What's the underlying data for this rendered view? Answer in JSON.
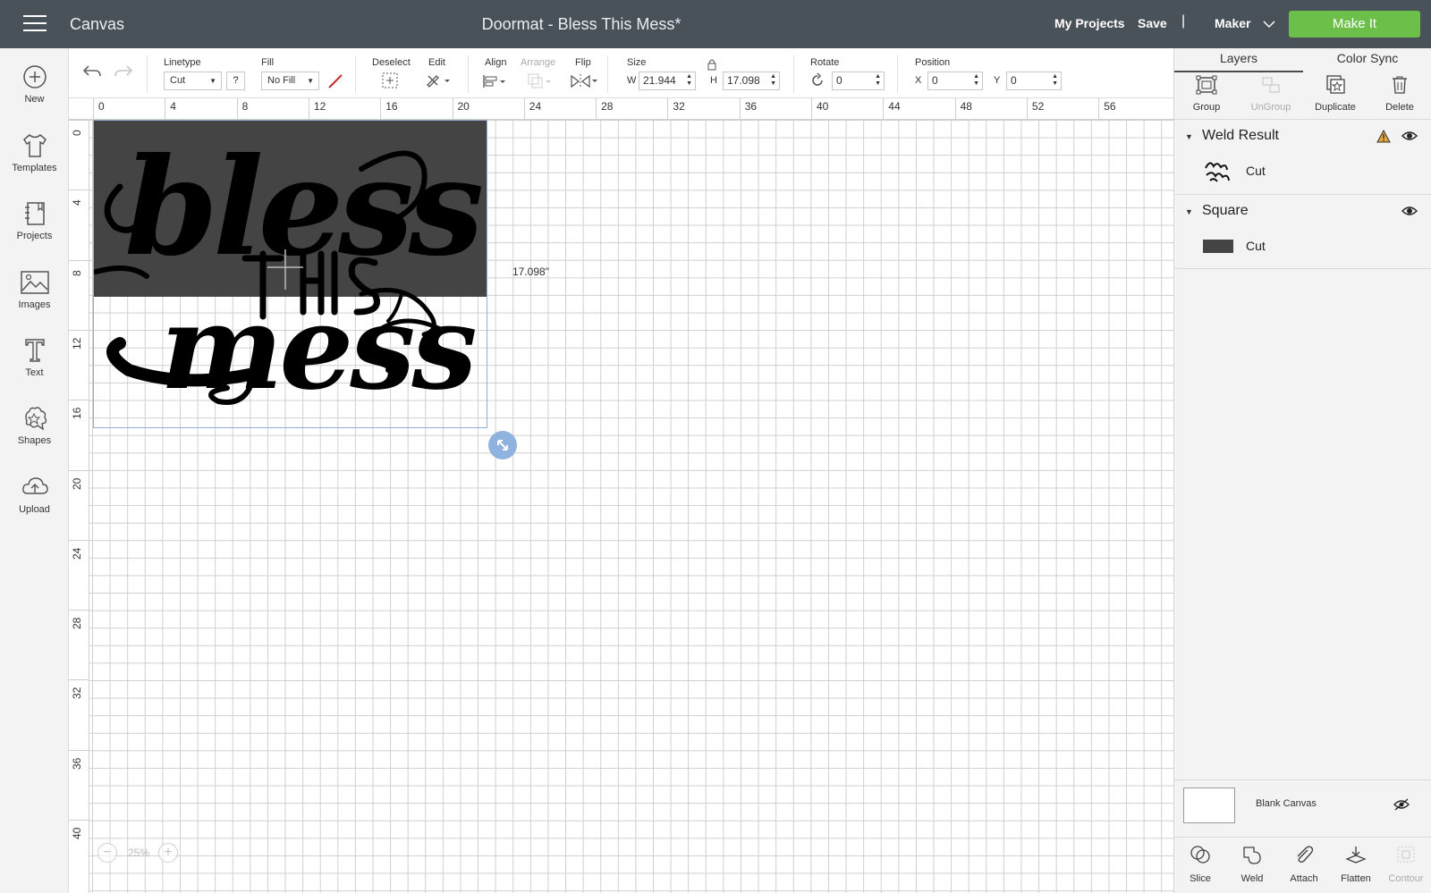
{
  "topbar": {
    "app_title": "Canvas",
    "document_title": "Doormat - Bless This Mess*",
    "my_projects": "My Projects",
    "save": "Save",
    "separator": "|",
    "machine": "Maker",
    "make_it": "Make It",
    "make_it_color": "#6cc04a",
    "bar_color": "#4a5259"
  },
  "leftnav": {
    "items": [
      {
        "label": "New",
        "icon": "plus-circle-icon"
      },
      {
        "label": "Templates",
        "icon": "shirt-icon"
      },
      {
        "label": "Projects",
        "icon": "notebook-icon"
      },
      {
        "label": "Images",
        "icon": "image-icon"
      },
      {
        "label": "Text",
        "icon": "text-t-icon"
      },
      {
        "label": "Shapes",
        "icon": "shapes-icon"
      },
      {
        "label": "Upload",
        "icon": "cloud-upload-icon"
      }
    ]
  },
  "toolbar": {
    "linetype_label": "Linetype",
    "linetype_value": "Cut",
    "help": "?",
    "fill_label": "Fill",
    "fill_value": "No Fill",
    "deselect_label": "Deselect",
    "edit_label": "Edit",
    "align_label": "Align",
    "arrange_label": "Arrange",
    "flip_label": "Flip",
    "size_label": "Size",
    "w_prefix": "W",
    "width": "21.944",
    "h_prefix": "H",
    "height": "17.098",
    "rotate_label": "Rotate",
    "rotate_value": "0",
    "position_label": "Position",
    "x_prefix": "X",
    "x_value": "0",
    "y_prefix": "Y",
    "y_value": "0"
  },
  "rulers": {
    "top": [
      "0",
      "4",
      "8",
      "12",
      "16",
      "20",
      "24",
      "28",
      "32",
      "36",
      "40",
      "44",
      "48",
      "52",
      "56"
    ],
    "left": [
      "0",
      "4",
      "8",
      "12",
      "16",
      "20",
      "24",
      "28",
      "32",
      "36",
      "40"
    ]
  },
  "canvas": {
    "dimension_label": "17.098\"",
    "zoom_level": "25%",
    "zoom_out": "−",
    "zoom_in": "+",
    "artwork_words": [
      "bless",
      "THIS",
      "mess"
    ]
  },
  "panel": {
    "tabs": [
      "Layers",
      "Color Sync"
    ],
    "actions": [
      {
        "label": "Group",
        "enabled": true
      },
      {
        "label": "UnGroup",
        "enabled": false
      },
      {
        "label": "Duplicate",
        "enabled": true
      },
      {
        "label": "Delete",
        "enabled": true
      }
    ],
    "layers": [
      {
        "name": "Weld Result",
        "child": "Cut",
        "warning": true
      },
      {
        "name": "Square",
        "child": "Cut",
        "warning": false
      }
    ],
    "blank_canvas": "Blank Canvas",
    "bottom_actions": [
      {
        "label": "Slice",
        "enabled": true
      },
      {
        "label": "Weld",
        "enabled": true
      },
      {
        "label": "Attach",
        "enabled": true
      },
      {
        "label": "Flatten",
        "enabled": true
      },
      {
        "label": "Contour",
        "enabled": false
      }
    ],
    "warning_color": "#e8a33a"
  }
}
